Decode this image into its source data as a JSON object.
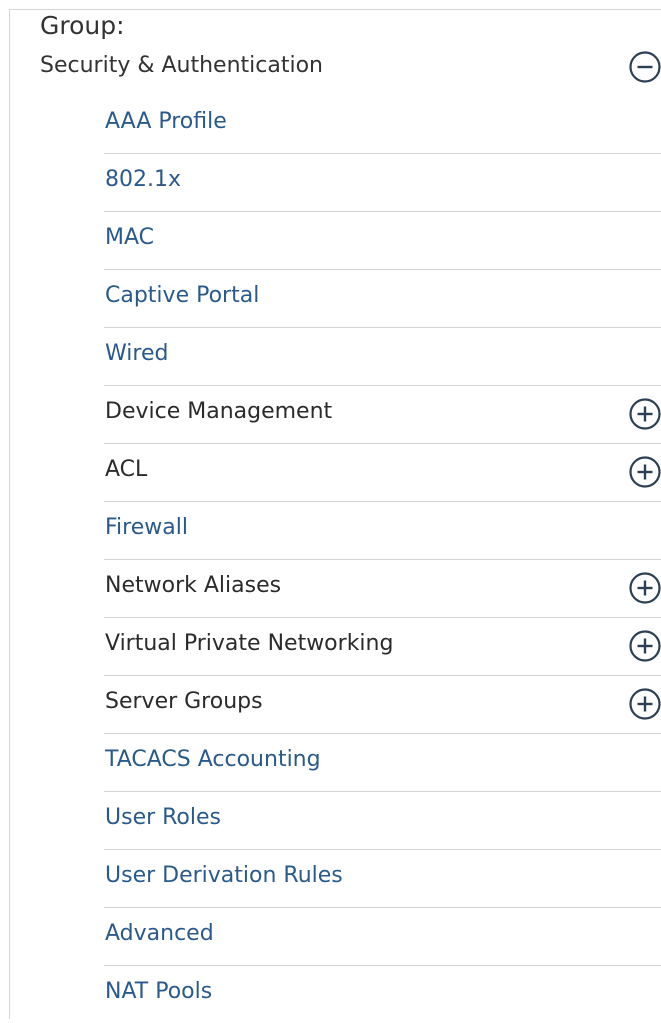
{
  "group": {
    "label": "Group:",
    "title": "Security & Authentication",
    "toggle_icon": "collapse-minus-icon"
  },
  "colors": {
    "link": "#2a5a8c",
    "parent_text": "#2b2b2b",
    "divider": "#d4d4d4",
    "icon": "#2b3f55"
  },
  "items": [
    {
      "label": "AAA Profile",
      "expandable": false
    },
    {
      "label": "802.1x",
      "expandable": false
    },
    {
      "label": "MAC",
      "expandable": false
    },
    {
      "label": "Captive Portal",
      "expandable": false
    },
    {
      "label": "Wired",
      "expandable": false
    },
    {
      "label": "Device Management",
      "expandable": true,
      "icon": "expand-plus-icon"
    },
    {
      "label": "ACL",
      "expandable": true,
      "icon": "expand-plus-icon"
    },
    {
      "label": "Firewall",
      "expandable": false
    },
    {
      "label": "Network Aliases",
      "expandable": true,
      "icon": "expand-plus-icon"
    },
    {
      "label": "Virtual Private Networking",
      "expandable": true,
      "icon": "expand-plus-icon"
    },
    {
      "label": "Server Groups",
      "expandable": true,
      "icon": "expand-plus-icon"
    },
    {
      "label": "TACACS Accounting",
      "expandable": false
    },
    {
      "label": "User Roles",
      "expandable": false
    },
    {
      "label": "User Derivation Rules",
      "expandable": false
    },
    {
      "label": "Advanced",
      "expandable": false
    },
    {
      "label": "NAT Pools",
      "expandable": false
    }
  ]
}
